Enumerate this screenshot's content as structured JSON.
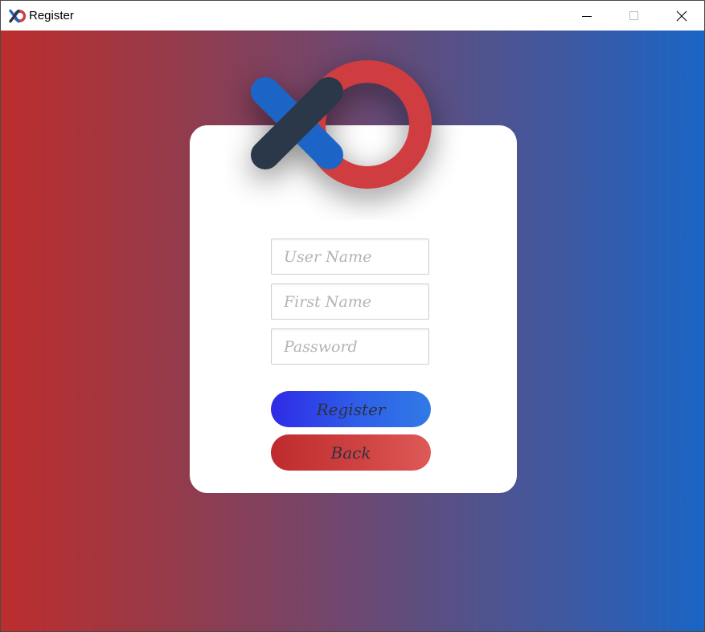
{
  "window": {
    "title": "Register",
    "app_icon": "xo-logo-icon",
    "controls": {
      "minimize_icon": "minimize-icon",
      "maximize_icon": "maximize-icon",
      "close_icon": "close-icon"
    }
  },
  "logo": {
    "icon": "xo-logo",
    "colors": {
      "x_blue": "#1a65c6",
      "x_dark": "#2c3748",
      "o_red": "#cf3d40"
    }
  },
  "form": {
    "username": {
      "placeholder": "User Name",
      "value": ""
    },
    "first_name": {
      "placeholder": "First Name",
      "value": ""
    },
    "password": {
      "placeholder": "Password",
      "value": ""
    }
  },
  "buttons": {
    "register_label": "Register",
    "back_label": "Back"
  },
  "colors": {
    "background_left": "#bd2d2e",
    "background_right": "#1a65c6",
    "register_gradient": [
      "#2f2ae6",
      "#2f7ae6"
    ],
    "back_gradient": [
      "#be2b2e",
      "#dc5a58"
    ],
    "button_text": "#2b3242"
  }
}
